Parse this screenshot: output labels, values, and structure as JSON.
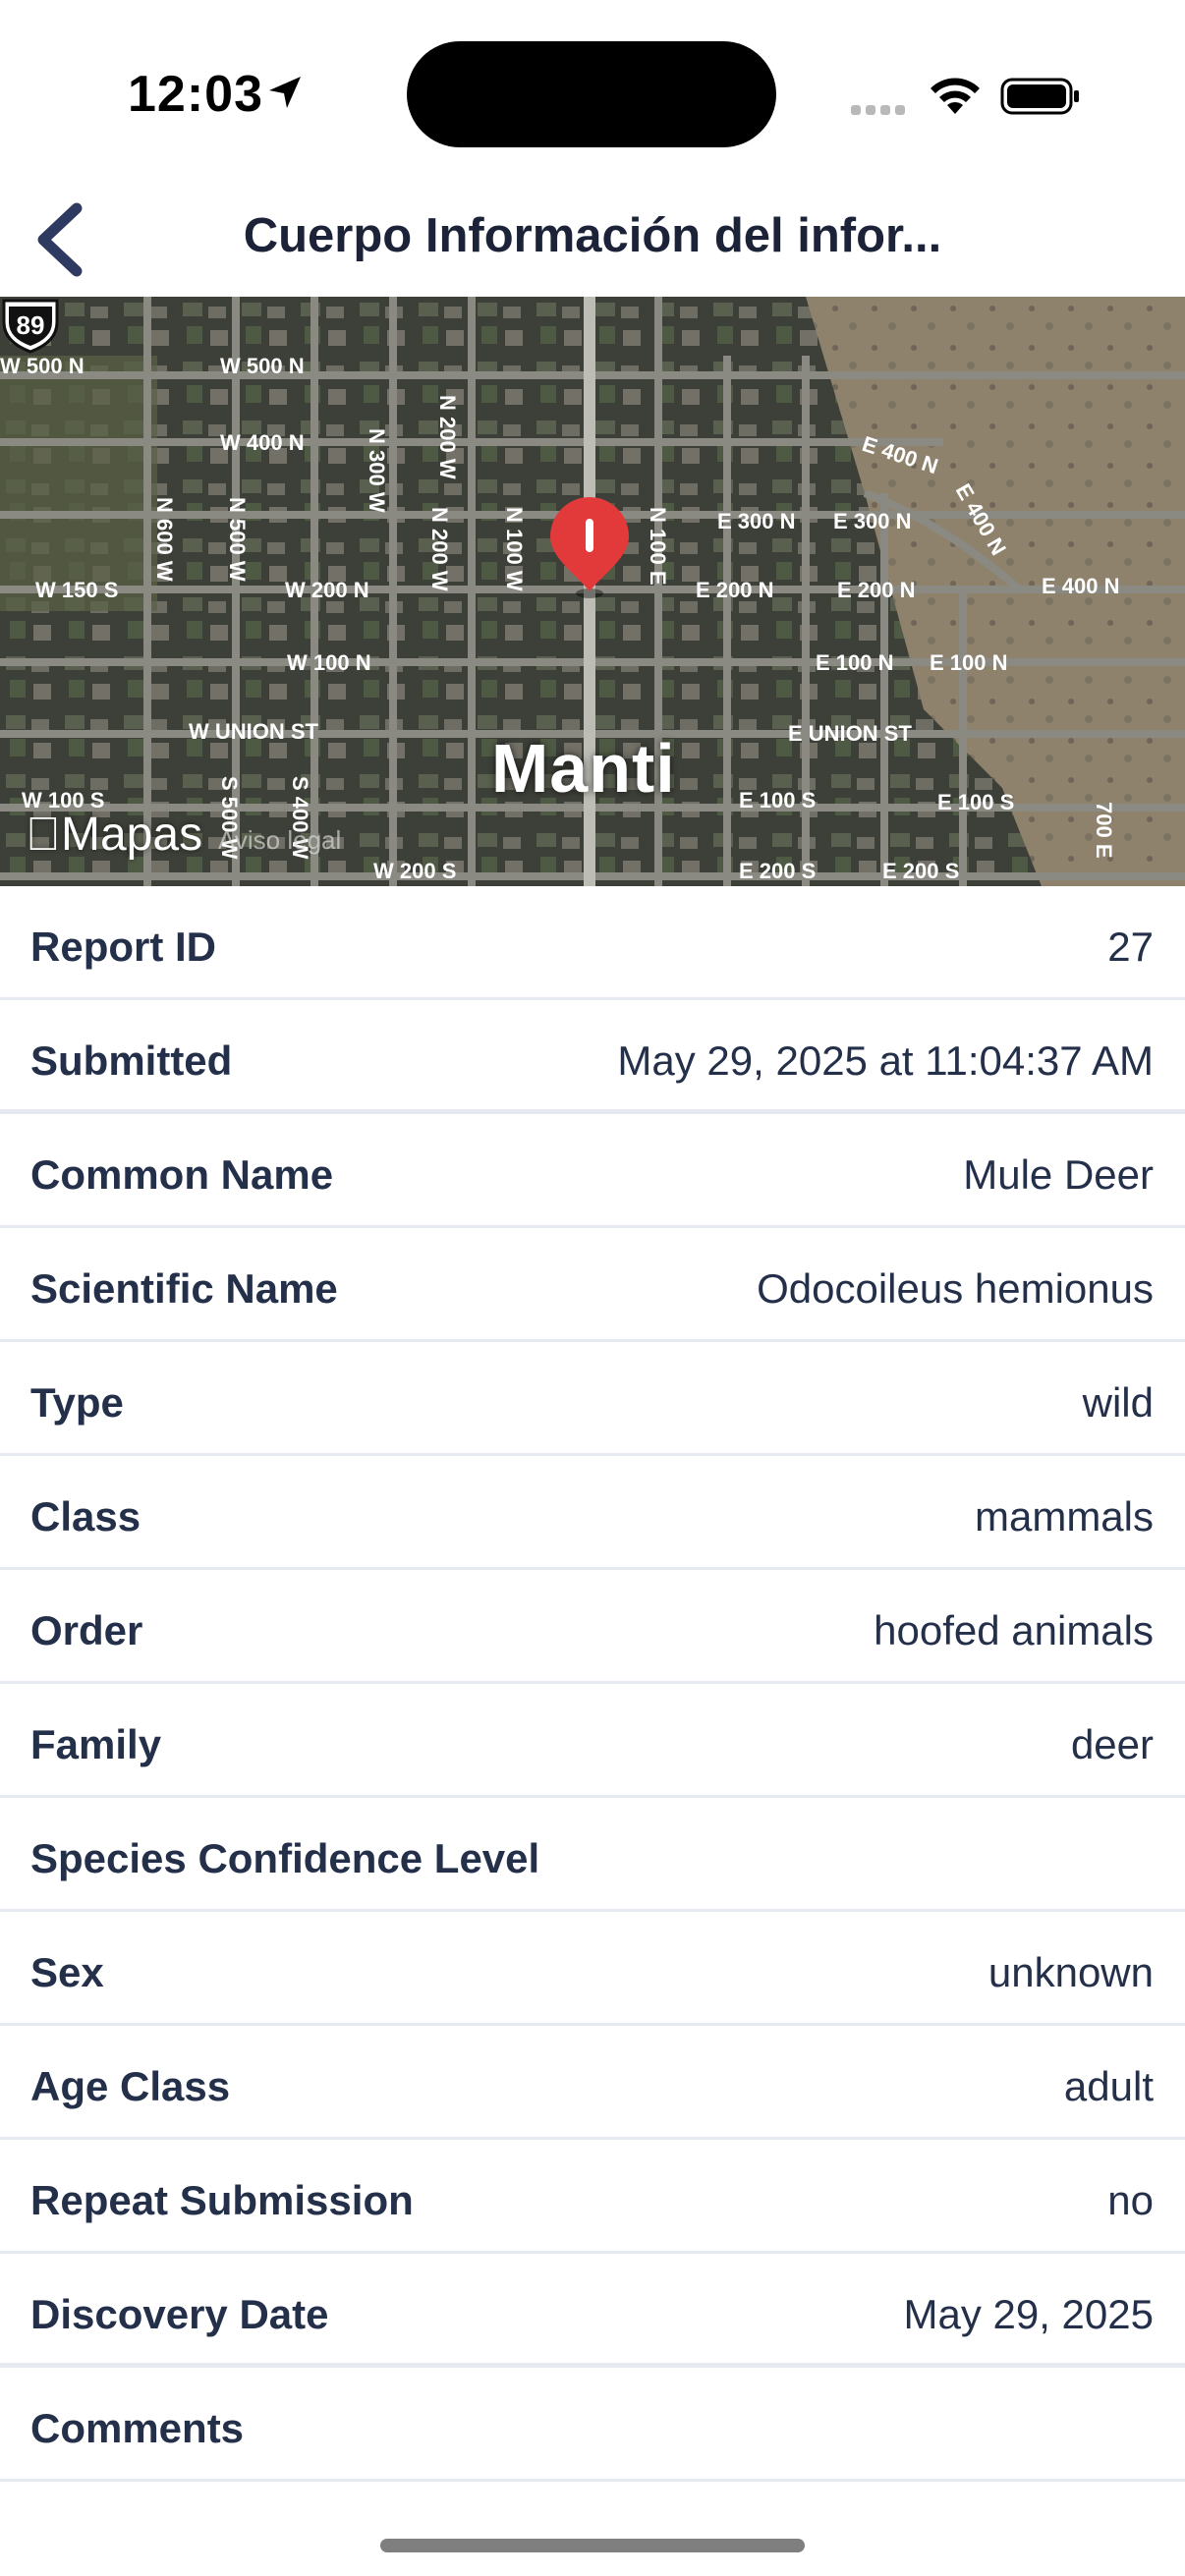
{
  "status_bar": {
    "time": "12:03"
  },
  "header": {
    "title": "Cuerpo Información del infor...",
    "back_icon": "chevron-left-icon"
  },
  "map": {
    "city_label": "Manti",
    "provider_label": "Mapas",
    "legal_label": "Aviso legal",
    "highway_number": "89",
    "street_labels": [
      "W 500 N",
      "W 500 N",
      "W 400 N",
      "E 400 N",
      "N 200 W",
      "N 300 W",
      "N 600 W",
      "N 500 W",
      "N 200 W",
      "N 100 W",
      "N 100 E",
      "E 300 N",
      "E 300 N",
      "E 400 N",
      "W 150 S",
      "W 200 N",
      "E 200 N",
      "E 200 N",
      "E 400 N",
      "W 100 N",
      "E 100 N",
      "E 100 N",
      "W UNION ST",
      "E UNION ST",
      "W 100 S",
      "E 100 S",
      "E 100 S",
      "S 500 W",
      "S 400 W",
      "W 200 S",
      "E 200 S",
      "E 200 S",
      "700 E"
    ],
    "pin_color": "#e23a3a"
  },
  "details": [
    {
      "label": "Report ID",
      "value": "27"
    },
    {
      "label": "Submitted",
      "value": "May 29, 2025 at 11:04:37 AM"
    },
    {
      "label": "Common Name",
      "value": "Mule Deer"
    },
    {
      "label": "Scientific Name",
      "value": "Odocoileus hemionus"
    },
    {
      "label": "Type",
      "value": "wild"
    },
    {
      "label": "Class",
      "value": "mammals"
    },
    {
      "label": "Order",
      "value": "hoofed animals"
    },
    {
      "label": "Family",
      "value": "deer"
    },
    {
      "label": "Species Confidence Level",
      "value": ""
    },
    {
      "label": "Sex",
      "value": "unknown"
    },
    {
      "label": "Age Class",
      "value": "adult"
    },
    {
      "label": "Repeat Submission",
      "value": "no"
    },
    {
      "label": "Discovery Date",
      "value": "May 29, 2025"
    },
    {
      "label": "Comments",
      "value": ""
    }
  ],
  "colors": {
    "text": "#24304a",
    "divider": "#e6e9ef",
    "back_chevron": "#2f3a60"
  }
}
